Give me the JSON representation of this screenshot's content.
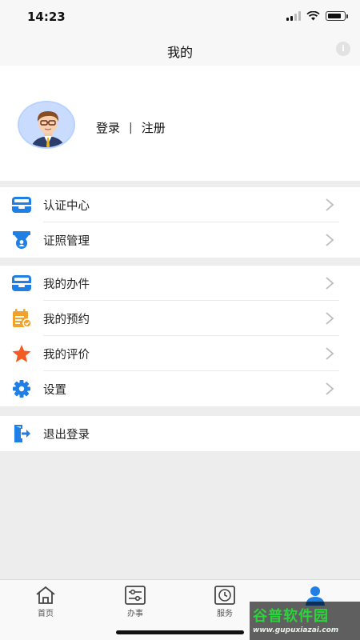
{
  "status_bar": {
    "time": "14:23"
  },
  "nav": {
    "title": "我的",
    "info_icon": "info-icon"
  },
  "profile": {
    "login_label": "登录",
    "separator": "|",
    "register_label": "注册",
    "avatar": "avatar-cartoon-man"
  },
  "groups": [
    {
      "items": [
        {
          "label": "认证中心",
          "icon": "inbox-tray-icon",
          "color": "#1f7fe5"
        },
        {
          "label": "证照管理",
          "icon": "certificate-badge-icon",
          "color": "#1f7fe5"
        }
      ]
    },
    {
      "items": [
        {
          "label": "我的办件",
          "icon": "inbox-tray-icon",
          "color": "#1f7fe5"
        },
        {
          "label": "我的预约",
          "icon": "calendar-check-icon",
          "color": "#f0a22a"
        },
        {
          "label": "我的评价",
          "icon": "star-icon",
          "color": "#f25c22"
        },
        {
          "label": "设置",
          "icon": "gear-icon",
          "color": "#1f7fe5"
        }
      ]
    },
    {
      "items": [
        {
          "label": "退出登录",
          "icon": "logout-icon",
          "color": "#1f7fe5"
        }
      ]
    }
  ],
  "tabs": [
    {
      "label": "首页",
      "icon": "home-icon"
    },
    {
      "label": "办事",
      "icon": "sliders-icon"
    },
    {
      "label": "服务",
      "icon": "clock-icon"
    },
    {
      "label": "",
      "icon": "user-icon",
      "active": true
    }
  ],
  "watermark": {
    "title": "谷普软件园",
    "url": "www.gupuxiazai.com"
  },
  "colors": {
    "accent": "#1f7fe5",
    "orange": "#f0a22a",
    "red_orange": "#f25c22",
    "background": "#ededed"
  }
}
